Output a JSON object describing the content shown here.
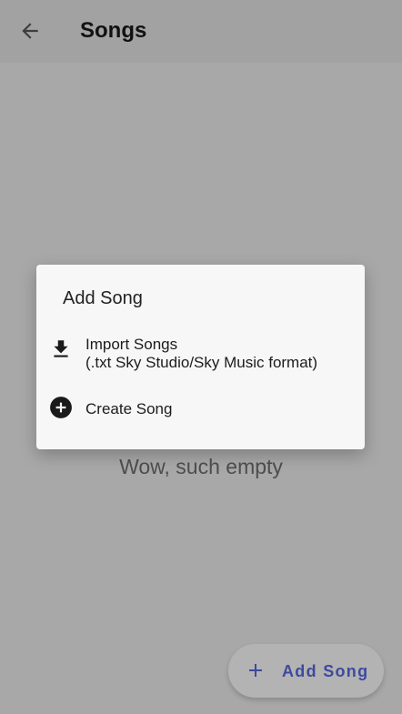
{
  "appbar": {
    "back_icon": "arrow-back-icon",
    "title": "Songs"
  },
  "main": {
    "empty_message": "Wow, such empty"
  },
  "dialog": {
    "title": "Add Song",
    "options": [
      {
        "icon": "download-icon",
        "label": "Import Songs",
        "sublabel": "(.txt Sky Studio/Sky Music format)"
      },
      {
        "icon": "add-circle-icon",
        "label": "Create Song"
      }
    ]
  },
  "fab": {
    "icon": "plus-icon",
    "label": "Add Song",
    "accent_color": "#3c4a9e"
  }
}
